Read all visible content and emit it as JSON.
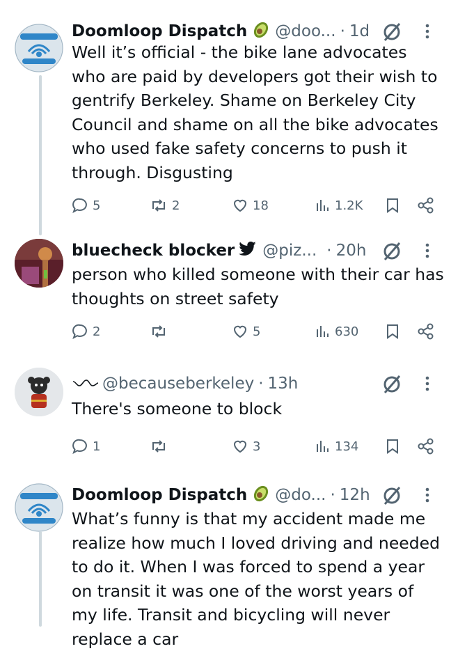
{
  "posts": [
    {
      "author": "Doomloop Dispatch",
      "badge_icon": "avocado-icon",
      "handle": "@doo...",
      "time": "1d",
      "text": "Well it’s official - the bike lane advocates who are paid by developers got their wish to gentrify Berkeley. Shame on Berkeley City Council and shame on all the bike advocates who used fake safety concerns to push it through. Disgusting",
      "replies": "5",
      "reposts": "2",
      "likes": "18",
      "views": "1.2K"
    },
    {
      "author": "bluecheck blocker",
      "badge_icon": "bird-icon",
      "handle": "@piz...",
      "time": "20h",
      "text": "person who killed someone with their car has thoughts on street safety",
      "replies": "2",
      "reposts": "",
      "likes": "5",
      "views": "630"
    },
    {
      "author": "",
      "badge_icon": "squiggle-icon",
      "handle": "@becauseberkeley",
      "time": "13h",
      "text": "There's someone to block",
      "replies": "1",
      "reposts": "",
      "likes": "3",
      "views": "134"
    },
    {
      "author": "Doomloop Dispatch",
      "badge_icon": "avocado-icon",
      "handle": "@do...",
      "time": "12h",
      "text": "What’s funny is that my accident made me realize how much I loved driving and needed to do it. When I was forced to spend a year on transit it was one of the worst years of my life. Transit and bicycling will never replace a car",
      "replies": "",
      "reposts": "",
      "likes": "",
      "views": ""
    }
  ],
  "separator": "·",
  "colors": {
    "text": "#0f1419",
    "muted": "#536471",
    "thread_line": "#cfd9de",
    "avatar_blue": "#3a8ed0"
  }
}
